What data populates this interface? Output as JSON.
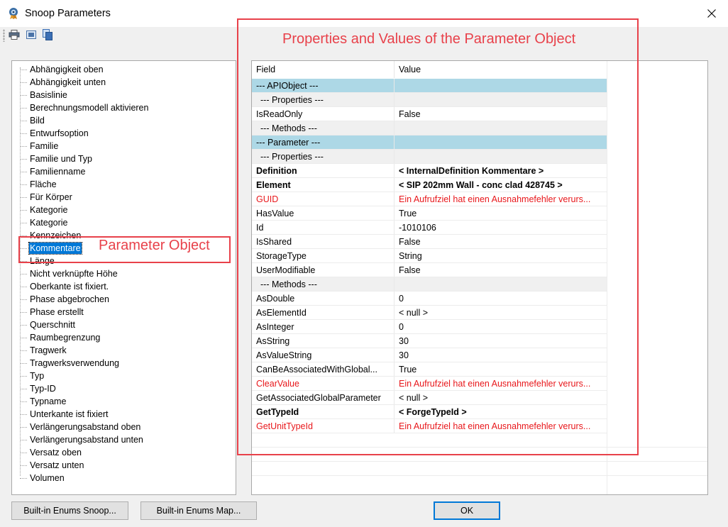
{
  "window": {
    "title": "Snoop Parameters"
  },
  "toolbar": {
    "icons": [
      "printer-icon",
      "print-preview-icon",
      "copy-icon"
    ]
  },
  "tree": {
    "items": [
      "Abhängigkeit oben",
      "Abhängigkeit unten",
      "Basislinie",
      "Berechnungsmodell aktivieren",
      "Bild",
      "Entwurfsoption",
      "Familie",
      "Familie und Typ",
      "Familienname",
      "Fläche",
      "Für Körper",
      "Kategorie",
      "Kategorie",
      "Kennzeichen",
      "Kommentare",
      "Länge",
      "Nicht verknüpfte Höhe",
      "Oberkante ist fixiert.",
      "Phase abgebrochen",
      "Phase erstellt",
      "Querschnitt",
      "Raumbegrenzung",
      "Tragwerk",
      "Tragwerksverwendung",
      "Typ",
      "Typ-ID",
      "Typname",
      "Unterkante ist fixiert",
      "Verlängerungsabstand oben",
      "Verlängerungsabstand unten",
      "Versatz oben",
      "Versatz unten",
      "Volumen"
    ],
    "selected_index": 14
  },
  "grid": {
    "headers": {
      "field": "Field",
      "value": "Value"
    },
    "rows": [
      {
        "field": "--- APIObject ---",
        "value": "",
        "kind": "section"
      },
      {
        "field": "--- Properties ---",
        "value": "",
        "kind": "sub"
      },
      {
        "field": "IsReadOnly",
        "value": "False",
        "kind": "normal"
      },
      {
        "field": "--- Methods ---",
        "value": "",
        "kind": "sub"
      },
      {
        "field": "--- Parameter ---",
        "value": "",
        "kind": "section"
      },
      {
        "field": "--- Properties ---",
        "value": "",
        "kind": "sub"
      },
      {
        "field": "Definition",
        "value": "< InternalDefinition  Kommentare >",
        "kind": "bold"
      },
      {
        "field": "Element",
        "value": "< SIP 202mm Wall - conc clad  428745 >",
        "kind": "bold"
      },
      {
        "field": "GUID",
        "value": "Ein Aufrufziel hat einen Ausnahmefehler verurs...",
        "kind": "err"
      },
      {
        "field": "HasValue",
        "value": "True",
        "kind": "normal"
      },
      {
        "field": "Id",
        "value": "-1010106",
        "kind": "normal"
      },
      {
        "field": "IsShared",
        "value": "False",
        "kind": "normal"
      },
      {
        "field": "StorageType",
        "value": "String",
        "kind": "normal"
      },
      {
        "field": "UserModifiable",
        "value": "False",
        "kind": "normal"
      },
      {
        "field": "--- Methods ---",
        "value": "",
        "kind": "sub"
      },
      {
        "field": "AsDouble",
        "value": "0",
        "kind": "normal"
      },
      {
        "field": "AsElementId",
        "value": "< null >",
        "kind": "normal"
      },
      {
        "field": "AsInteger",
        "value": "0",
        "kind": "normal"
      },
      {
        "field": "AsString",
        "value": "30",
        "kind": "normal"
      },
      {
        "field": "AsValueString",
        "value": "30",
        "kind": "normal"
      },
      {
        "field": "CanBeAssociatedWithGlobal...",
        "value": "True",
        "kind": "normal"
      },
      {
        "field": "ClearValue",
        "value": "Ein Aufrufziel hat einen Ausnahmefehler verurs...",
        "kind": "err"
      },
      {
        "field": "GetAssociatedGlobalParameter",
        "value": "< null >",
        "kind": "normal"
      },
      {
        "field": "GetTypeId",
        "value": "< ForgeTypeId >",
        "kind": "bold"
      },
      {
        "field": "GetUnitTypeId",
        "value": "Ein Aufrufziel hat einen Ausnahmefehler verurs...",
        "kind": "err"
      }
    ]
  },
  "annotations": {
    "param_object": "Parameter Object",
    "props_values": "Properties and Values of the Parameter Object",
    "color": "#e8414a"
  },
  "buttons": {
    "enums_snoop": "Built-in Enums Snoop...",
    "enums_map": "Built-in Enums Map...",
    "ok": "OK"
  },
  "colors": {
    "section_bg": "#add8e6",
    "error_text": "#e8171b",
    "selection": "#0078d7"
  }
}
